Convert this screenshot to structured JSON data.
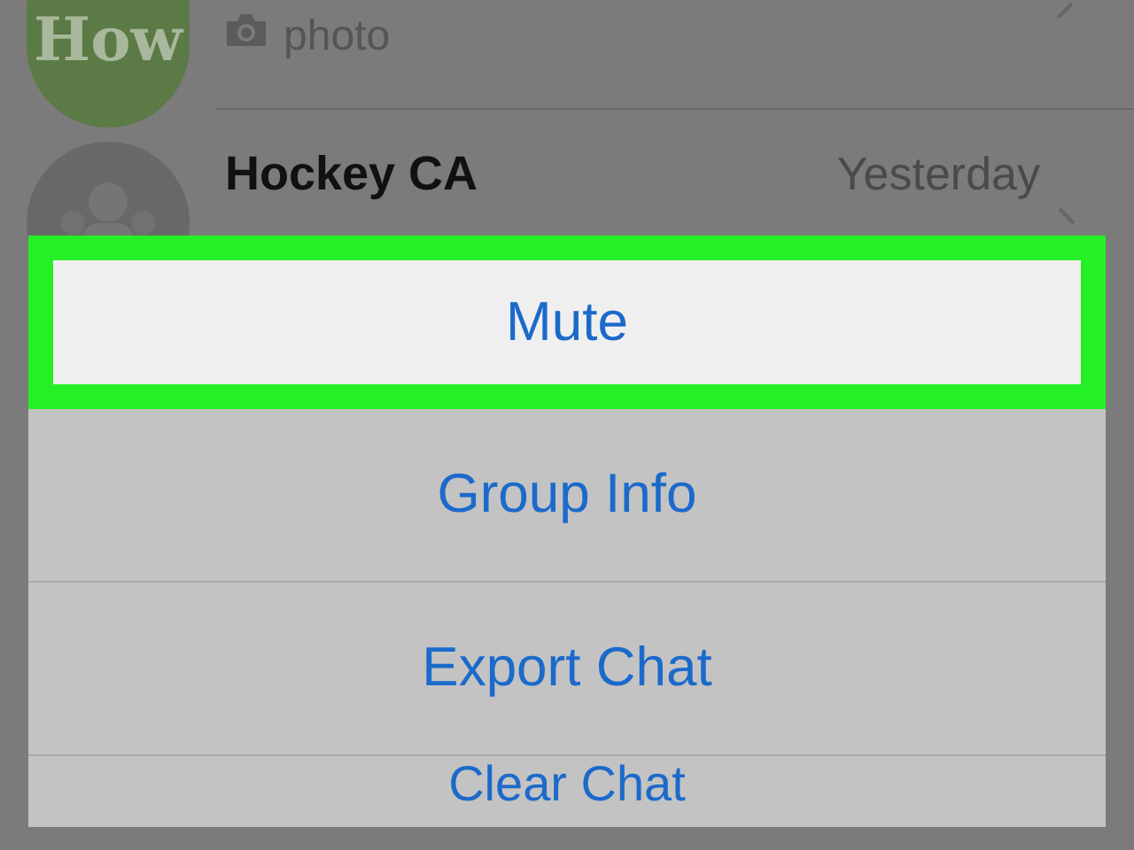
{
  "chats": [
    {
      "avatar": {
        "kind": "logo",
        "text": "How"
      },
      "preview": {
        "kind": "photo",
        "text": "photo"
      }
    },
    {
      "name": "Hockey CA",
      "time": "Yesterday",
      "avatar": {
        "kind": "group"
      }
    }
  ],
  "action_sheet": [
    {
      "label": "Mute",
      "highlighted": true
    },
    {
      "label": "Group Info",
      "highlighted": false
    },
    {
      "label": "Export Chat",
      "highlighted": false
    },
    {
      "label": "Clear Chat",
      "highlighted": false
    }
  ]
}
